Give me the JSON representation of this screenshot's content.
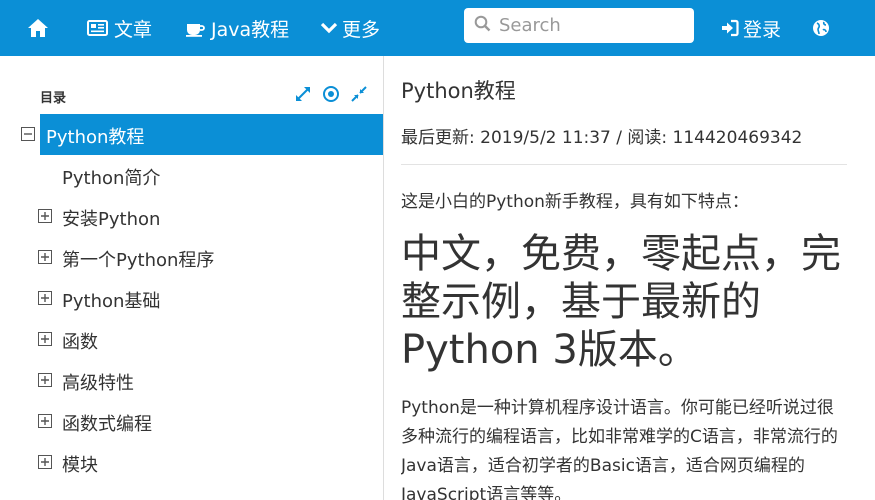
{
  "nav": {
    "home_icon": "home-icon",
    "articles": "文章",
    "java": "Java教程",
    "more": "更多",
    "search_placeholder": "Search",
    "login": "登录",
    "globe_icon": "globe-icon"
  },
  "sidebar": {
    "heading": "目录",
    "tools": [
      "expand-icon",
      "target-icon",
      "collapse-icon"
    ],
    "items": [
      {
        "label": "Python教程",
        "toggle": "minus",
        "level": 0,
        "active": true
      },
      {
        "label": "Python简介",
        "toggle": "none",
        "level": 1
      },
      {
        "label": "安装Python",
        "toggle": "plus",
        "level": 1
      },
      {
        "label": "第一个Python程序",
        "toggle": "plus",
        "level": 1
      },
      {
        "label": "Python基础",
        "toggle": "plus",
        "level": 1
      },
      {
        "label": "函数",
        "toggle": "plus",
        "level": 1
      },
      {
        "label": "高级特性",
        "toggle": "plus",
        "level": 1
      },
      {
        "label": "函数式编程",
        "toggle": "plus",
        "level": 1
      },
      {
        "label": "模块",
        "toggle": "plus",
        "level": 1
      }
    ]
  },
  "content": {
    "title": "Python教程",
    "meta": "最后更新: 2019/5/2 11:37 / 阅读: 114420469342",
    "intro": "这是小白的Python新手教程，具有如下特点：",
    "headline": "中文，免费，零起点，完整示例，基于最新的Python 3版本。",
    "paragraph": "Python是一种计算机程序设计语言。你可能已经听说过很多种流行的编程语言，比如非常难学的C语言，非常流行的Java语言，适合初学者的Basic语言，适合网页编程的JavaScript语言等等。"
  },
  "colors": {
    "accent": "#0b8fd6"
  }
}
